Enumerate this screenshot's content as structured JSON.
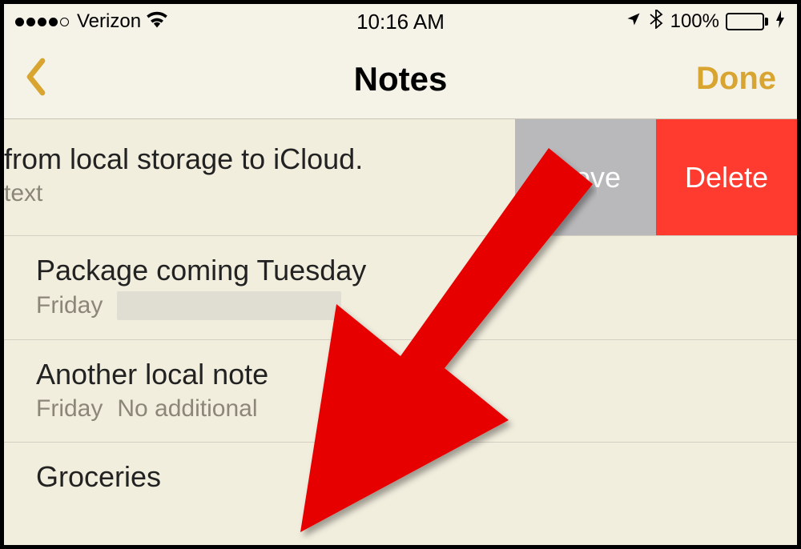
{
  "statusBar": {
    "carrier": "Verizon",
    "time": "10:16 AM",
    "batteryPct": "100%"
  },
  "nav": {
    "title": "Notes",
    "done": "Done"
  },
  "swipeActions": {
    "move": "Move",
    "delete": "Delete"
  },
  "notes": [
    {
      "title": "from local storage to iCloud.",
      "date": "",
      "preview": "text",
      "swiped": true
    },
    {
      "title": "Package coming Tuesday",
      "date": "Friday",
      "preview": "",
      "redacted": true
    },
    {
      "title": "Another local note",
      "date": "Friday",
      "preview": "No additional"
    },
    {
      "title": "Groceries",
      "date": "",
      "preview": ""
    }
  ]
}
